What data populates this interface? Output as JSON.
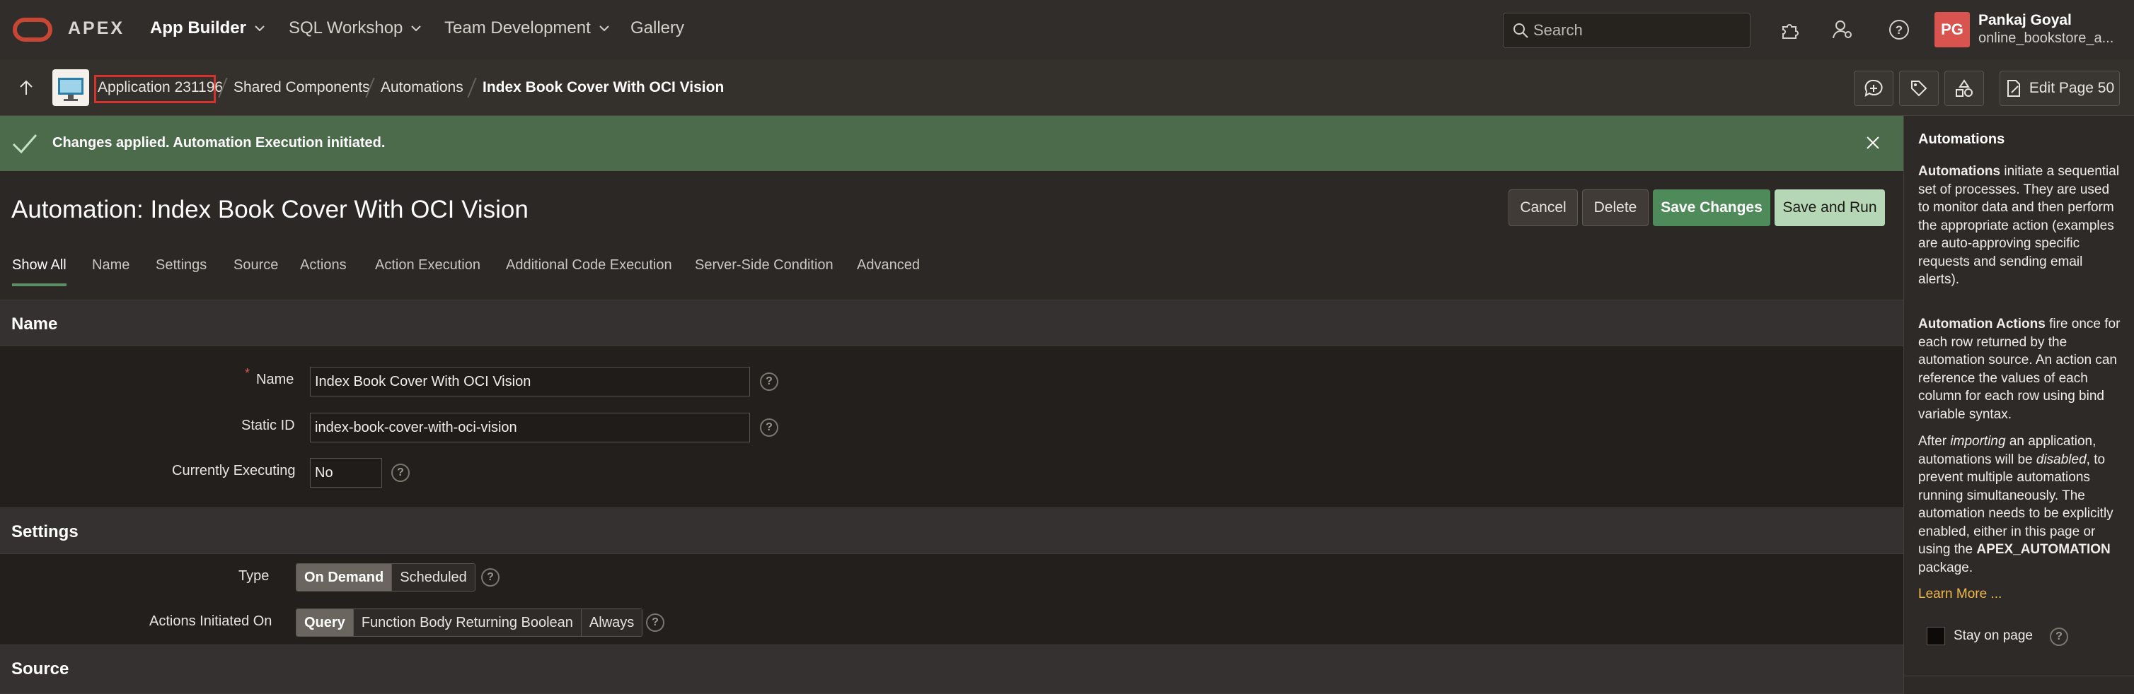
{
  "topnav": {
    "brand": "APEX",
    "items": [
      {
        "label": "App Builder",
        "has_menu": true
      },
      {
        "label": "SQL Workshop",
        "has_menu": true
      },
      {
        "label": "Team Development",
        "has_menu": true
      },
      {
        "label": "Gallery",
        "has_menu": false
      }
    ],
    "search_placeholder": "Search",
    "user": {
      "initials": "PG",
      "name": "Pankaj Goyal",
      "workspace": "online_bookstore_a..."
    }
  },
  "breadcrumb": {
    "items": [
      "Application 231196",
      "Shared Components",
      "Automations",
      "Index Book Cover With OCI Vision"
    ],
    "edit_page_label": "Edit Page 50"
  },
  "alert": {
    "message": "Changes applied. Automation Execution initiated.",
    "color": "#4b6b4b"
  },
  "page": {
    "title": "Automation: Index Book Cover With OCI Vision",
    "buttons": {
      "cancel": "Cancel",
      "delete": "Delete",
      "save": "Save Changes",
      "save_run": "Save and Run"
    }
  },
  "tabs": [
    "Show All",
    "Name",
    "Settings",
    "Source",
    "Actions",
    "Action Execution",
    "Additional Code Execution",
    "Server-Side Condition",
    "Advanced"
  ],
  "name_section": {
    "heading": "Name",
    "name_label": "Name",
    "name_value": "Index Book Cover With OCI Vision",
    "static_id_label": "Static ID",
    "static_id_value": "index-book-cover-with-oci-vision",
    "executing_label": "Currently Executing",
    "executing_value": "No"
  },
  "settings_section": {
    "heading": "Settings",
    "type_label": "Type",
    "type_options": [
      "On Demand",
      "Scheduled"
    ],
    "type_selected": "On Demand",
    "actions_label": "Actions Initiated On",
    "actions_options": [
      "Query",
      "Function Body Returning Boolean",
      "Always"
    ],
    "actions_selected": "Query"
  },
  "source_section": {
    "heading": "Source"
  },
  "help_panel": {
    "title": "Automations",
    "p1_bold": "Automations",
    "p1_rest": " initiate a sequential set of processes. They are used to monitor data and then perform the appropriate action (examples are auto-approving specific requests and sending email alerts).",
    "p2_bold": "Automation Actions",
    "p2_rest": " fire once for each row returned by the automation source. An action can reference the values of each column for each row using bind variable syntax.",
    "p3_a": "After ",
    "p3_i1": "importing",
    "p3_b": " an application, automations will be ",
    "p3_i2": "disabled",
    "p3_c": ", to prevent multiple automations running simultaneously. The automation needs to be explicitly enabled, either in this page or using the ",
    "p3_bold": "APEX_AUTOMATION",
    "p3_d": " package.",
    "learn_more": "Learn More ...",
    "stay_label": "Stay on page"
  }
}
